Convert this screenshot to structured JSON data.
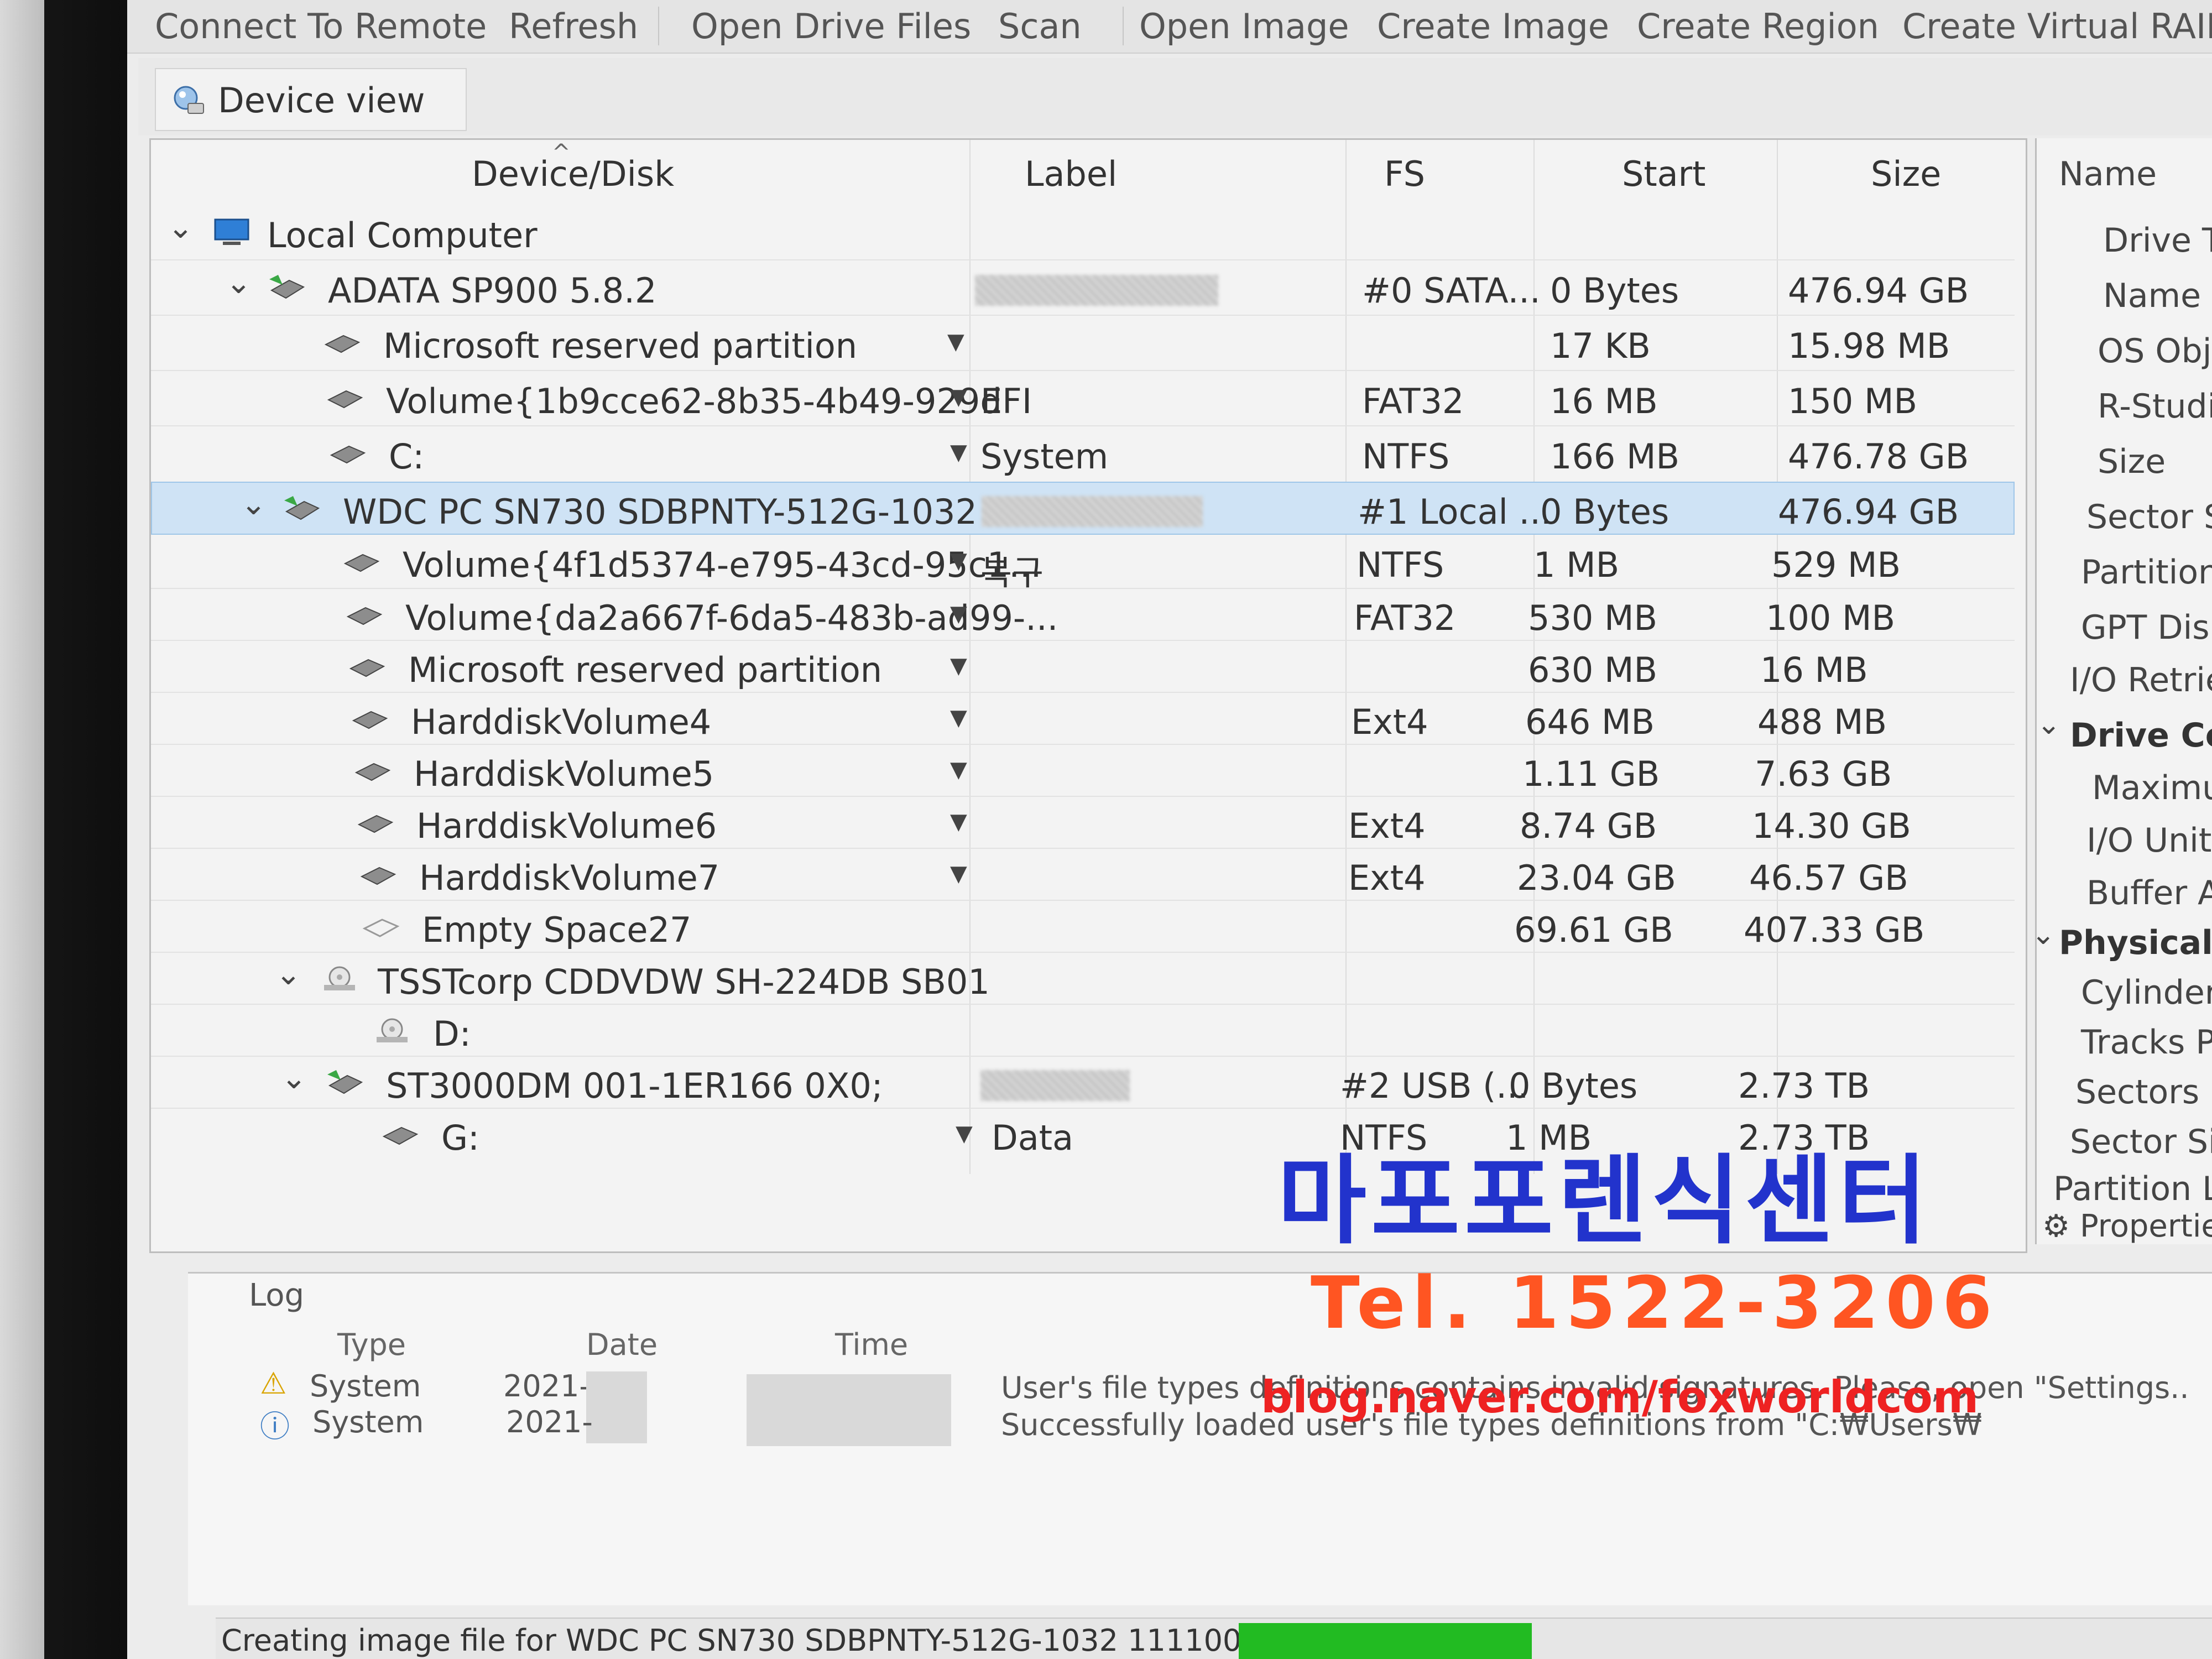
{
  "toolbar": {
    "connect_remote": "Connect To Remote",
    "refresh": "Refresh",
    "open_drive_files": "Open Drive Files",
    "scan": "Scan",
    "open_image": "Open Image",
    "create_image": "Create Image",
    "create_region": "Create Region",
    "create_virtual_raid": "Create Virtual RAID"
  },
  "tabs": {
    "device_view": "Device view"
  },
  "tree": {
    "columns": {
      "device": "Device/Disk",
      "label": "Label",
      "fs": "FS",
      "start": "Start",
      "size": "Size"
    },
    "rows": [
      {
        "name": "Local Computer",
        "label": "",
        "fs": "",
        "start": "",
        "size": ""
      },
      {
        "name": "ADATA SP900 5.8.2",
        "label": "",
        "fs": "#0 SATA...",
        "start": "0 Bytes",
        "size": "476.94 GB"
      },
      {
        "name": "Microsoft reserved partition",
        "label": "",
        "fs": "",
        "start": "17 KB",
        "size": "15.98 MB"
      },
      {
        "name": "Volume{1b9cce62-8b35-4b49-929d",
        "label": "EFI",
        "fs": "FAT32",
        "start": "16 MB",
        "size": "150 MB"
      },
      {
        "name": "C:",
        "label": "System",
        "fs": "NTFS",
        "start": "166 MB",
        "size": "476.78 GB"
      },
      {
        "name": "WDC PC SN730 SDBPNTY-512G-1032 ...",
        "label": "",
        "fs": "#1 Local ...",
        "start": "0 Bytes",
        "size": "476.94 GB"
      },
      {
        "name": "Volume{4f1d5374-e795-43cd-95c1...",
        "label": "복구",
        "fs": "NTFS",
        "start": "1 MB",
        "size": "529 MB"
      },
      {
        "name": "Volume{da2a667f-6da5-483b-ad99-...",
        "label": "",
        "fs": "FAT32",
        "start": "530 MB",
        "size": "100 MB"
      },
      {
        "name": "Microsoft reserved partition",
        "label": "",
        "fs": "",
        "start": "630 MB",
        "size": "16 MB"
      },
      {
        "name": "HarddiskVolume4",
        "label": "",
        "fs": "Ext4",
        "start": "646 MB",
        "size": "488 MB"
      },
      {
        "name": "HarddiskVolume5",
        "label": "",
        "fs": "",
        "start": "1.11 GB",
        "size": "7.63 GB"
      },
      {
        "name": "HarddiskVolume6",
        "label": "",
        "fs": "Ext4",
        "start": "8.74 GB",
        "size": "14.30 GB"
      },
      {
        "name": "HarddiskVolume7",
        "label": "",
        "fs": "Ext4",
        "start": "23.04 GB",
        "size": "46.57 GB"
      },
      {
        "name": "Empty Space27",
        "label": "",
        "fs": "",
        "start": "69.61 GB",
        "size": "407.33 GB"
      },
      {
        "name": "TSSTcorp CDDVDW SH-224DB SB01",
        "label": "",
        "fs": "",
        "start": "",
        "size": ""
      },
      {
        "name": "D:",
        "label": "",
        "fs": "",
        "start": "",
        "size": ""
      },
      {
        "name": "ST3000DM 001-1ER166 0X0;",
        "label": "",
        "fs": "#2 USB (...",
        "start": "0 Bytes",
        "size": "2.73 TB"
      },
      {
        "name": "G:",
        "label": "Data",
        "fs": "NTFS",
        "start": "1 MB",
        "size": "2.73 TB"
      }
    ]
  },
  "properties": {
    "header": "Name",
    "items": [
      "Drive T",
      "Name",
      "OS Obje",
      "R-Studio",
      "Size",
      "Sector Si",
      "Partition S",
      "GPT Disk",
      "I/O Retries",
      "Drive Cont",
      "Maximu",
      "I/O Unit",
      "Buffer A",
      "Physical Dri",
      "Cylinders",
      "Tracks Per",
      "Sectors Pe",
      "Sector Size",
      "Partition Layou"
    ],
    "tab_label": "Properties"
  },
  "log": {
    "title": "Log",
    "columns": {
      "type": "Type",
      "date": "Date",
      "time": "Time"
    },
    "entries": [
      {
        "type": "System",
        "date": "2021-",
        "message": "User's file types definitions contains invalid signatures. Please, open \"Settings.."
      },
      {
        "type": "System",
        "date": "2021-",
        "message": "Successfully loaded user's file types definitions from \"C:₩Users₩"
      }
    ]
  },
  "status": {
    "text": "Creating image file for WDC PC SN730 SDBPNTY-512G-1032 11110000",
    "progress_color": "#22bb22"
  },
  "watermark": {
    "korean": "마포포렌식센터",
    "tel": "Tel. 1522-3206",
    "blog": "blog.naver.com/foxworldcom"
  }
}
